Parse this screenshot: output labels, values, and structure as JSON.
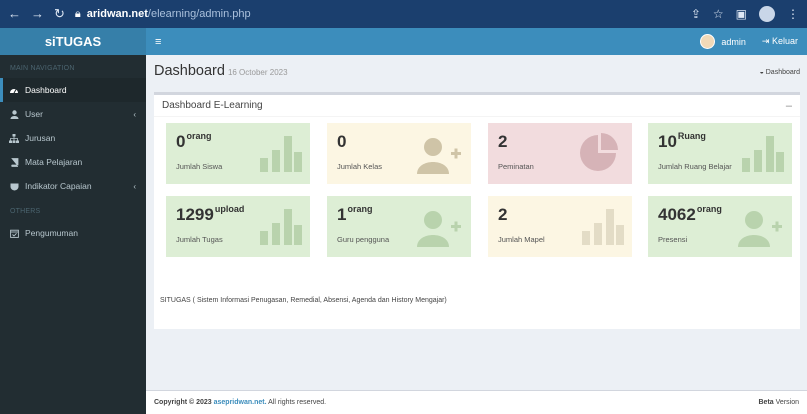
{
  "browser": {
    "url_host": "aridwan.net",
    "url_path": "/elearning/admin.php"
  },
  "brand": "siTUGAS",
  "sidebar": {
    "main_header": "MAIN NAVIGATION",
    "others_header": "OTHERS",
    "items": [
      {
        "label": "Dashboard",
        "icon": "dashboard-icon",
        "active": true
      },
      {
        "label": "User",
        "icon": "user-icon",
        "caret": true
      },
      {
        "label": "Jurusan",
        "icon": "sitemap-icon"
      },
      {
        "label": "Mata Pelajaran",
        "icon": "book-icon"
      },
      {
        "label": "Indikator Capaian",
        "icon": "shield-icon",
        "caret": true
      }
    ],
    "others_items": [
      {
        "label": "Pengumuman",
        "icon": "calendar-icon"
      }
    ]
  },
  "navbar": {
    "user": "admin",
    "logout": "Keluar"
  },
  "page": {
    "title": "Dashboard",
    "date": "16 October 2023",
    "breadcrumb": "Dashboard"
  },
  "box": {
    "title": "Dashboard E-Learning",
    "collapse": "–"
  },
  "tiles": [
    {
      "value": "0",
      "unit": "orang",
      "label": "Jumlah Siswa",
      "color": "#ddeed5",
      "icon": "bar-chart-icon"
    },
    {
      "value": "0",
      "unit": "",
      "label": "Jumlah Kelas",
      "color": "#fcf6e3",
      "icon": "user-plus-icon"
    },
    {
      "value": "2",
      "unit": "",
      "label": "Peminatan",
      "color": "#f2dcde",
      "icon": "pie-chart-icon"
    },
    {
      "value": "10",
      "unit": "Ruang",
      "label": "Jumlah Ruang Belajar",
      "color": "#ddeed5",
      "icon": "bar-chart-icon"
    },
    {
      "value": "1299",
      "unit": "upload",
      "label": "Jumlah Tugas",
      "color": "#ddeed5",
      "icon": "bar-chart-icon"
    },
    {
      "value": "1",
      "unit": "orang",
      "label": "Guru pengguna",
      "color": "#ddeed5",
      "icon": "user-plus-icon"
    },
    {
      "value": "2",
      "unit": "",
      "label": "Jumlah Mapel",
      "color": "#fcf6e3",
      "icon": "bar-chart-icon"
    },
    {
      "value": "4062",
      "unit": "orang",
      "label": "Presensi",
      "color": "#ddeed5",
      "icon": "user-plus-icon"
    }
  ],
  "info_text": "SITUGAS ( Sistem Informasi Penugasan, Remedial, Absensi, Agenda dan History Mengajar)",
  "footer": {
    "copyright_prefix": "Copyright © 2023",
    "link": "asepridwan.net.",
    "suffix": "All rights reserved.",
    "version_bold": "Beta",
    "version": "Version"
  }
}
